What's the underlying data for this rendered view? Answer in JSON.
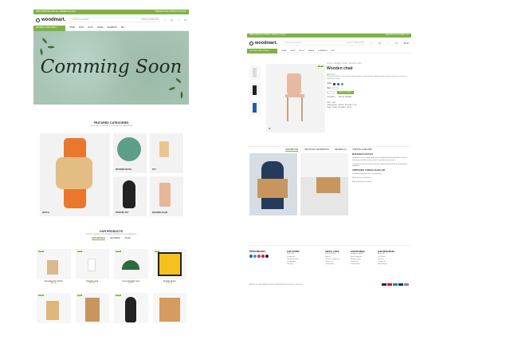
{
  "left": {
    "topbar": {
      "left": "FREE SHIPPING FOR ALL ORDERS OF $150",
      "right": "NEWSLETTER   CONTACT US   FAQS"
    },
    "logo": "woodmart.",
    "search_placeholder": "Search for products",
    "category_select": "SELECT CATEGORY",
    "nav": {
      "browse": "BROWSE CATEGORIES",
      "items": [
        "HOME",
        "SHOP",
        "BLOG",
        "PAGES",
        "ELEMENTS",
        "BUY"
      ]
    },
    "hero_title": "Comming Soon",
    "featured": {
      "title": "FEATURED CATEGORIES",
      "subtitle": "Lorem ipsum dolor sit amet consectetur adipiscing"
    },
    "categories": [
      {
        "label": "WATCH"
      },
      {
        "label": "WOODEN WATCH"
      },
      {
        "label": "TOY"
      },
      {
        "label": "PENGUIN TOY"
      },
      {
        "label": "WOODEN CHAIR"
      }
    ],
    "products": {
      "title": "OUR PRODUCTS",
      "subtitle": "Visit our website to get amazing products from our designers",
      "tabs": [
        "NEW ARRIVALS",
        "FEATURED",
        "SALES"
      ],
      "items": [
        {
          "name": "Decorative Pen Holder",
          "price": "$45.00",
          "badge": "NEW"
        },
        {
          "name": "Hanging Lamp",
          "price": "$62.00",
          "badge": "NEW"
        },
        {
          "name": "Green Pendant Lamp",
          "price": "$59.00",
          "badge": "NEW"
        },
        {
          "name": "Abstract Poster",
          "price": "$39.00",
          "badge": "NEW"
        },
        {
          "name": "",
          "price": "",
          "badge": "NEW"
        },
        {
          "name": "",
          "price": "",
          "badge": "NEW"
        },
        {
          "name": "",
          "price": "",
          "badge": "NEW"
        },
        {
          "name": "",
          "price": "",
          "badge": ""
        }
      ]
    }
  },
  "right": {
    "topbar": {
      "left": "FREE SHIPPING FOR ALL ORDERS OF $150",
      "right": "NEWSLETTER   CONTACT US"
    },
    "logo": "woodmart.",
    "search_placeholder": "Search for products",
    "category_select": "SELECT CATEGORY",
    "cart": "$0.00",
    "nav": {
      "browse": "BROWSE CATEGORIES",
      "items": [
        "HOME",
        "SHOP",
        "BLOG",
        "PAGES",
        "ELEMENTS",
        "BUY"
      ]
    },
    "breadcrumb": "Home / Wooden Chair / Wooden chair",
    "product": {
      "title": "Wooden chair",
      "price": "$119.00",
      "short_desc": "Phasellus lobortis justo sit amet mollis feugiat. Pellentesque habitant morbi tristique senectus et netus et malesuada fames.",
      "color_label": "Color",
      "size_label": "Size",
      "add_to_cart": "ADD TO CART",
      "compare": "Compare",
      "wishlist": "Add to wishlist",
      "sku": "SKU: N/A",
      "categories": "Categories: Chairs, Wooden, Toy",
      "tags": "Tags: Chair, Wooden Chair"
    },
    "desc_tabs": [
      "DESCRIPTION",
      "ADDITIONAL INFORMATION",
      "REVIEWS (0)",
      "SHIPPING & DELIVERY"
    ],
    "desc": {
      "heading": "MAECENAS IACULIS",
      "p1": "Vestibulum curae torquent diam diam commodo parturient penatibus nunc dui adipiscing convallis bulum parturient suspendisse parturient a.",
      "p2": "Lorem ipsum dolor sit amet consectetur adipiscing elit sed do eiusmod tempor incididunt.",
      "heading2": "ADIPISCING CONVALLIS BULUM",
      "bullets": [
        "Vestibulum penatibus nunc dui adipiscing",
        "Mattis aenean consectetur",
        "Eget suspendisse parturient"
      ]
    },
    "footer": {
      "brand": "Woodmart.",
      "cols": [
        {
          "title": "OUR STORES",
          "items": [
            "New York",
            "London SF",
            "Cockfosters BP",
            "Los Angeles",
            "Chicago"
          ]
        },
        {
          "title": "USEFUL LINKS",
          "items": [
            "Privacy Policy",
            "Returns",
            "Terms & Conditions",
            "Contact Us",
            "Latest News"
          ]
        },
        {
          "title": "FOOTER MENU",
          "items": [
            "Instagram profile",
            "New Collection",
            "Woman Dress",
            "Contact Us",
            "Latest News"
          ]
        },
        {
          "title": "OUR RESOURCES",
          "items": [
            "About Us",
            "Our Team",
            "Services",
            "Contact Us",
            "Latest News"
          ]
        }
      ],
      "copyright": "Based on WoodMart theme 2024 WooCommerce Themes."
    }
  },
  "colors": {
    "accent": "#7cb342",
    "hero_bg": "#a7c4b4"
  }
}
